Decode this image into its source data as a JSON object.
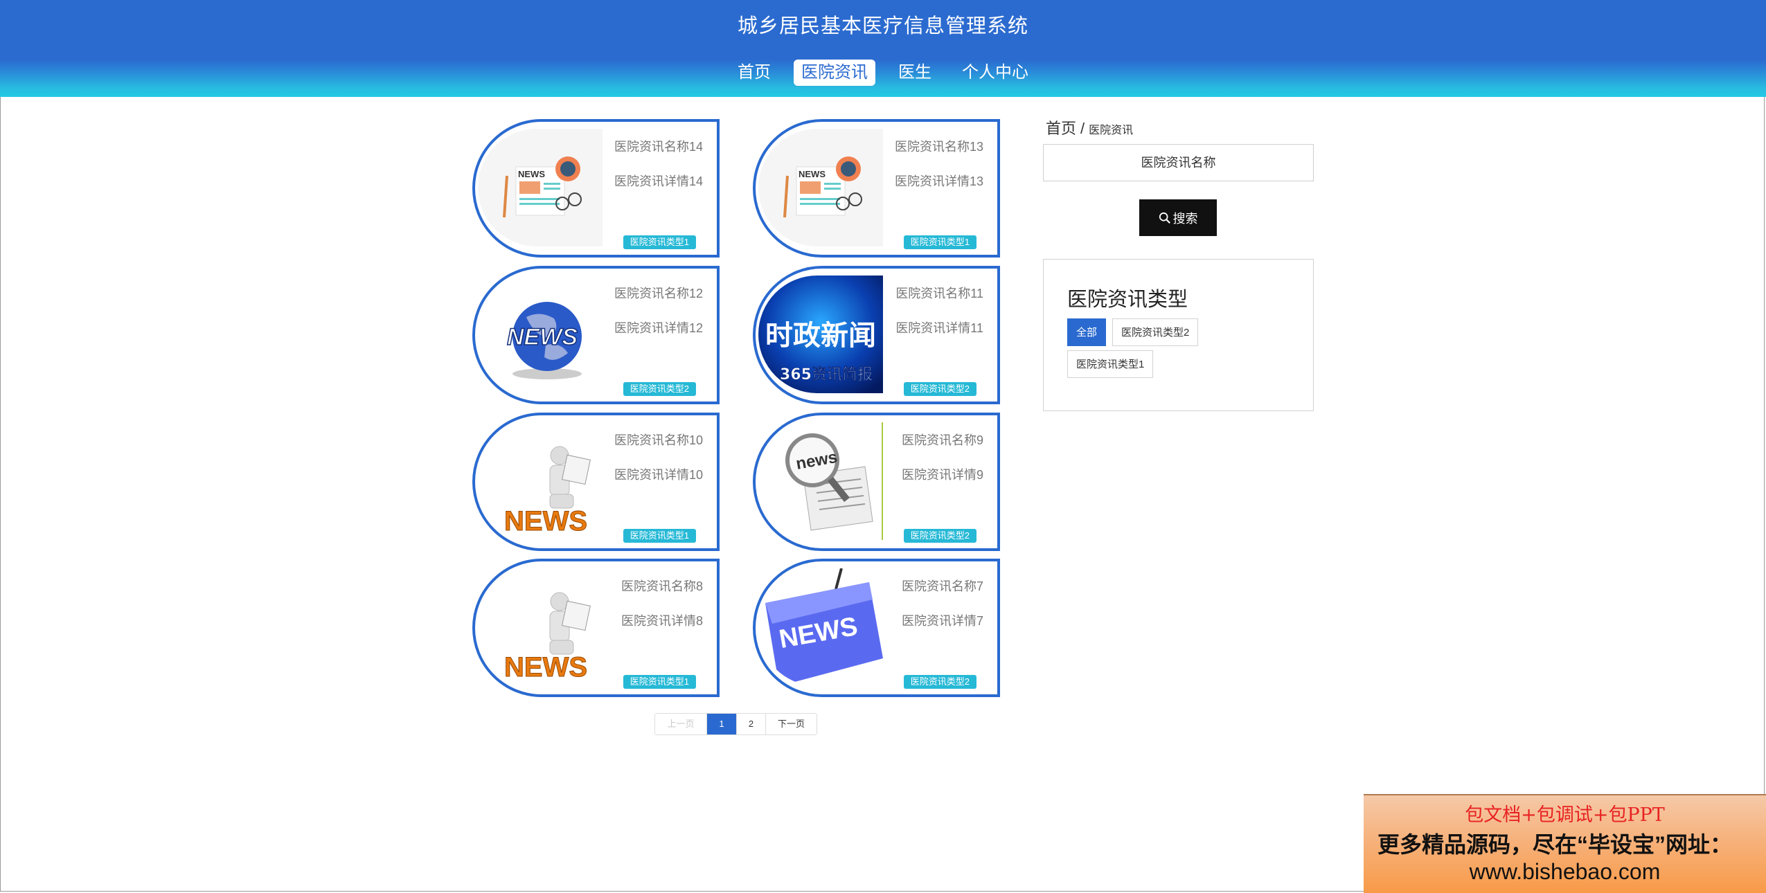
{
  "header": {
    "title": "城乡居民基本医疗信息管理系统",
    "nav": [
      {
        "label": "首页",
        "active": false
      },
      {
        "label": "医院资讯",
        "active": true
      },
      {
        "label": "医生",
        "active": false
      },
      {
        "label": "个人中心",
        "active": false
      }
    ]
  },
  "news": [
    {
      "title": "医院资讯名称14",
      "detail": "医院资讯详情14",
      "tag": "医院资讯类型1",
      "image": "news-paper-icon"
    },
    {
      "title": "医院资讯名称13",
      "detail": "医院资讯详情13",
      "tag": "医院资讯类型1",
      "image": "news-paper-icon"
    },
    {
      "title": "医院资讯名称12",
      "detail": "医院资讯详情12",
      "tag": "医院资讯类型2",
      "image": "news-globe-icon"
    },
    {
      "title": "医院资讯名称11",
      "detail": "医院资讯详情11",
      "tag": "医院资讯类型2",
      "image": "news-banner-image",
      "image_text": [
        "时政新闻",
        "365资讯简报"
      ]
    },
    {
      "title": "医院资讯名称10",
      "detail": "医院资讯详情10",
      "tag": "医院资讯类型1",
      "image": "news-reader-figure"
    },
    {
      "title": "医院资讯名称9",
      "detail": "医院资讯详情9",
      "tag": "医院资讯类型2",
      "image": "news-magnifier-icon"
    },
    {
      "title": "医院资讯名称8",
      "detail": "医院资讯详情8",
      "tag": "医院资讯类型1",
      "image": "news-reader-figure"
    },
    {
      "title": "医院资讯名称7",
      "detail": "医院资讯详情7",
      "tag": "医院资讯类型2",
      "image": "news-key-icon"
    }
  ],
  "pagination": {
    "prev": "上一页",
    "pages": [
      "1",
      "2"
    ],
    "current": "1",
    "next": "下一页"
  },
  "sidebar": {
    "breadcrumb": {
      "home": "首页",
      "separator": "/",
      "current": "医院资讯"
    },
    "search": {
      "placeholder": "医院资讯名称",
      "button": "搜索"
    },
    "types": {
      "title": "医院资讯类型",
      "items": [
        {
          "label": "全部",
          "active": true
        },
        {
          "label": "医院资讯类型2",
          "active": false
        },
        {
          "label": "医院资讯类型1",
          "active": false
        }
      ]
    }
  },
  "ad": {
    "line1": "包文档+包调试+包PPT",
    "line2": "更多精品源码，尽在“毕设宝”网址：",
    "line3": "www.bishebao.com"
  },
  "colors": {
    "header": "#2b6bd0",
    "accent": "#2a6ad0",
    "tag": "#26b9d6",
    "button": "#111111"
  }
}
